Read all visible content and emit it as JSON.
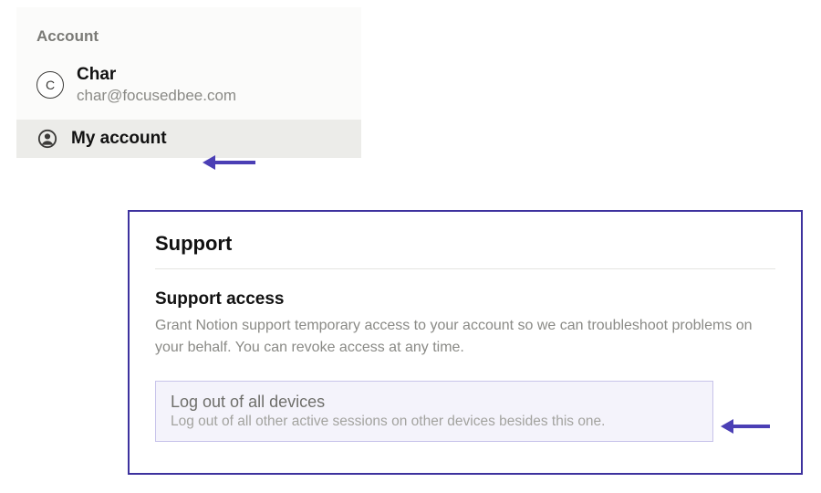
{
  "sidebar": {
    "section_label": "Account",
    "avatar_initial": "C",
    "profile": {
      "name": "Char",
      "email": "char@focusedbee.com"
    },
    "items": [
      {
        "label": "My account"
      }
    ]
  },
  "support": {
    "title": "Support",
    "access_heading": "Support access",
    "access_description": "Grant Notion support temporary access to your account so we can troubleshoot problems on your behalf. You can revoke access at any time.",
    "logout": {
      "title": "Log out of all devices",
      "description": "Log out of all other active sessions on other devices besides this one."
    }
  }
}
